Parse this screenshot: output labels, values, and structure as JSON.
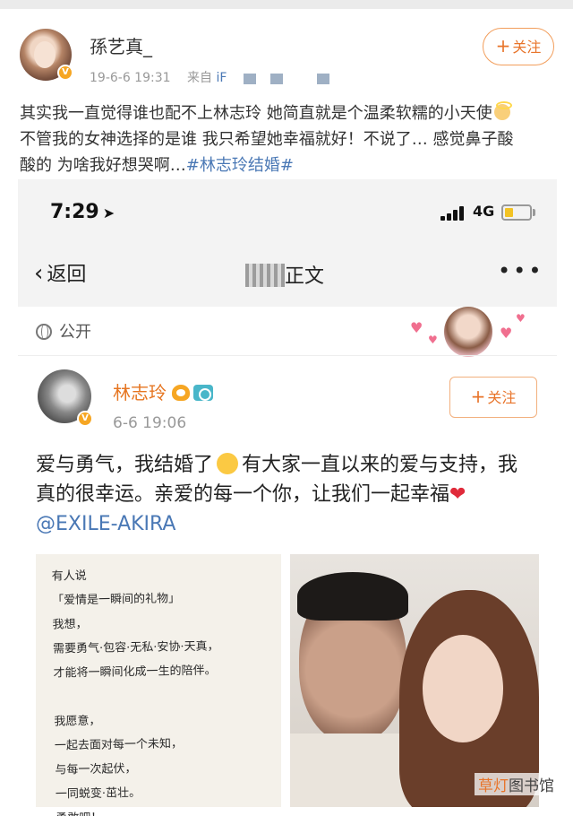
{
  "outer_post": {
    "username": "孫艺真_",
    "date": "19-6-6 19:31",
    "source_prefix": "来自",
    "source_visible": "iF",
    "follow_label": "关注",
    "text_line1": "其实我一直觉得谁也配不上林志玲  她简直就是个温柔软糯的小天使",
    "text_line2": "不管我的女神选择的是谁  我只希望她幸福就好！不说了… 感觉鼻子酸",
    "text_line3": "酸的  为啥我好想哭啊…",
    "hashtag": "#林志玲结婚#"
  },
  "phone": {
    "status_time": "7:29",
    "network": "4G",
    "battery_level": 0.35,
    "nav_back_label": "返回",
    "nav_title_visible": "正文",
    "more_label": "•••",
    "visibility_label": "公开",
    "inner_post": {
      "username": "林志玲",
      "date": "6-6 19:06",
      "follow_label": "关注",
      "text_part1": "爱与勇气，我结婚了",
      "text_part2": "有大家一直以来的爱与支持，我真的很幸运。亲爱的每一个你，让我们一起幸福",
      "mention": "@EXILE-AKIRA"
    },
    "handwritten_note": [
      "有人说",
      "「爱情是一瞬间的礼物」",
      "我想，",
      "需要勇气·包容·无私·安协·天真，",
      "才能将一瞬间化成一生的陪伴。",
      "",
      "我愿意，",
      "一起去面对每一个未知，",
      "与每一次起伏，",
      "一同蜕变·茁壮。",
      "勇敢吧！"
    ]
  },
  "watermark": {
    "part_a": "草灯",
    "part_b": "图书馆"
  },
  "colors": {
    "accent_orange": "#e8742a",
    "link_blue": "#4a78b5",
    "verified_gold": "#f6a623"
  }
}
